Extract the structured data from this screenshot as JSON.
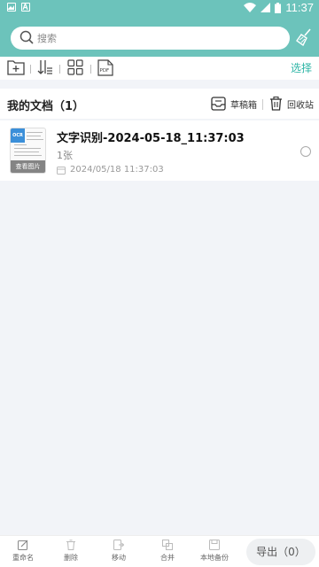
{
  "status_bar": {
    "time": "11:37"
  },
  "search": {
    "placeholder": "搜索"
  },
  "toolbar": {
    "select_label": "选择"
  },
  "section": {
    "title": "我的文档（1）",
    "drafts_label": "草稿箱",
    "recycle_label": "回收站"
  },
  "documents": [
    {
      "name": "文字识别-2024-05-18_11:37:03",
      "count": "1张",
      "date": "2024/05/18 11:37:03",
      "thumb_badge": "OCR",
      "thumb_label": "查看图片"
    }
  ],
  "bottom_bar": {
    "rename": "重命名",
    "delete": "删除",
    "move": "移动",
    "merge": "合并",
    "backup": "本地备份",
    "export": "导出（0）"
  },
  "colors": {
    "accent": "#6cc3bb",
    "link": "#2eb5a6"
  },
  "icons": [
    "image-icon",
    "font-icon",
    "wifi-icon",
    "signal-icon",
    "battery-icon",
    "search-icon",
    "broom-icon",
    "new-folder-icon",
    "sort-icon",
    "grid-icon",
    "pdf-icon",
    "drafts-icon",
    "trash-icon",
    "calendar-icon",
    "rename-icon",
    "delete-icon",
    "move-icon",
    "merge-icon",
    "backup-icon"
  ]
}
